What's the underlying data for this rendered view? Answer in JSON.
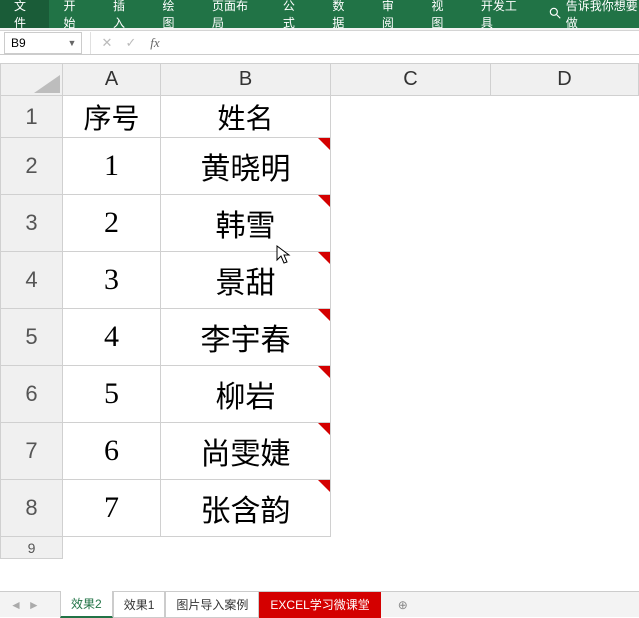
{
  "ribbon": {
    "tabs": [
      "文件",
      "开始",
      "插入",
      "绘图",
      "页面布局",
      "公式",
      "数据",
      "审阅",
      "视图",
      "开发工具"
    ],
    "search_placeholder": "告诉我你想要做"
  },
  "formula_bar": {
    "name_box_value": "B9",
    "formula_value": ""
  },
  "columns": [
    "A",
    "B",
    "C",
    "D"
  ],
  "rows": [
    "1",
    "2",
    "3",
    "4",
    "5",
    "6",
    "7",
    "8",
    "9"
  ],
  "table": {
    "header": {
      "A": "序号",
      "B": "姓名"
    },
    "data": [
      {
        "A": "1",
        "B": "黄晓明"
      },
      {
        "A": "2",
        "B": "韩雪"
      },
      {
        "A": "3",
        "B": "景甜"
      },
      {
        "A": "4",
        "B": "李宇春"
      },
      {
        "A": "5",
        "B": "柳岩"
      },
      {
        "A": "6",
        "B": "尚雯婕"
      },
      {
        "A": "7",
        "B": "张含韵"
      }
    ]
  },
  "sheet_tabs": {
    "items": [
      "效果2",
      "效果1",
      "图片导入案例",
      "EXCEL学习微课堂"
    ],
    "active_index": 0,
    "red_index": 3
  }
}
